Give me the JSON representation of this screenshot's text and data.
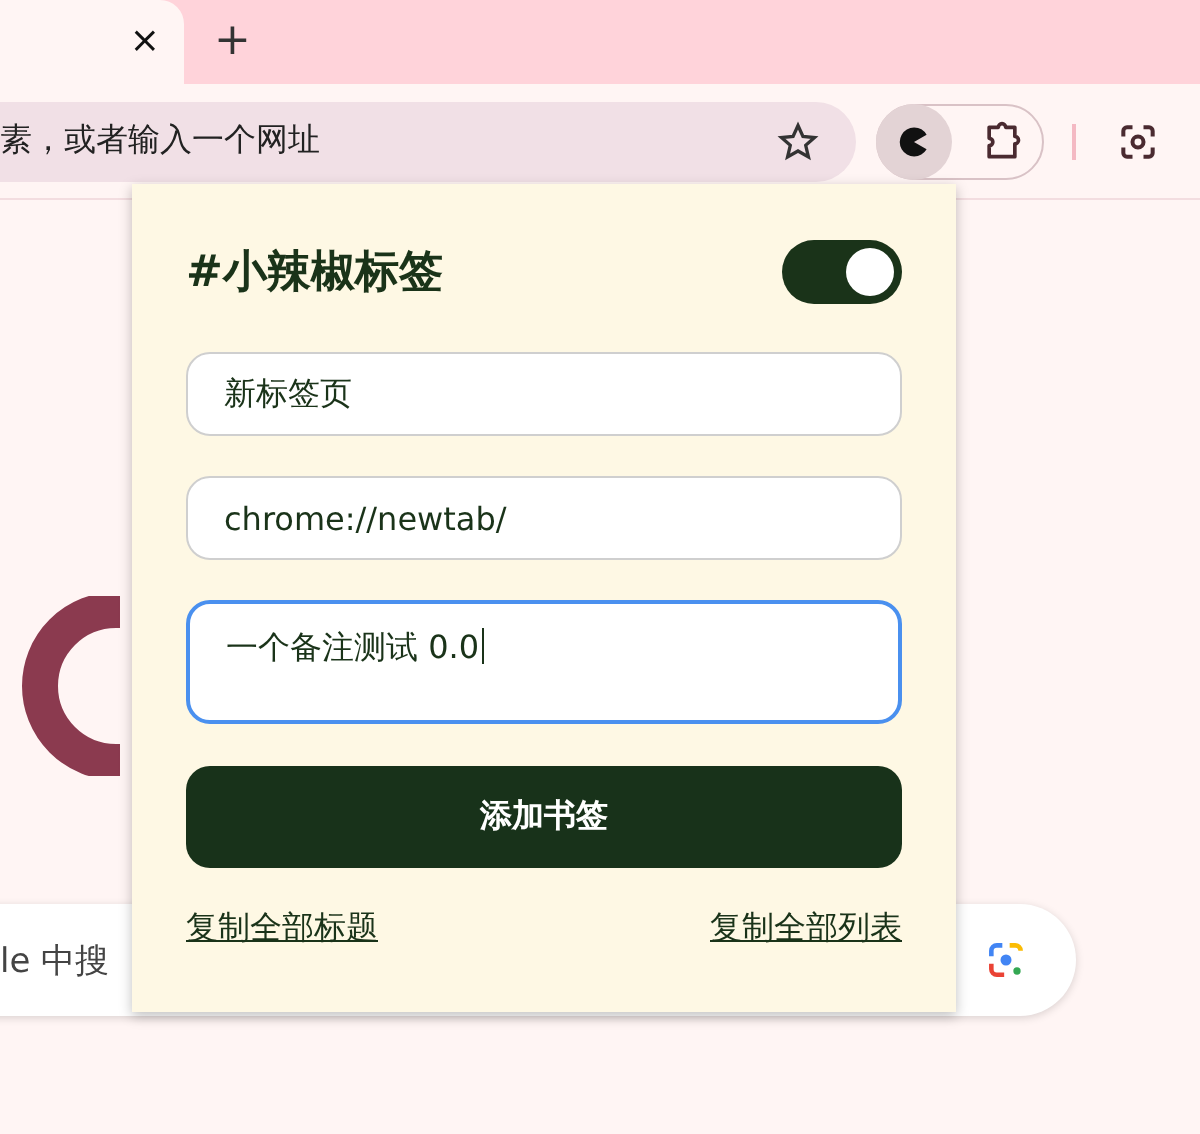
{
  "browser": {
    "tab_close": "×",
    "new_tab": "+",
    "address": "素，或者输入一个网址",
    "search_text": "le 中搜"
  },
  "popup": {
    "title": "#小辣椒标签",
    "enabled": true,
    "fields": [
      {
        "kind": "input",
        "value": "新标签页",
        "focused": false
      },
      {
        "kind": "input",
        "value": "chrome://newtab/",
        "focused": false
      },
      {
        "kind": "textarea",
        "value": "一个备注测试 0.0",
        "focused": true
      }
    ],
    "button": "添加书签",
    "links": [
      "复制全部标题",
      "复制全部列表"
    ]
  }
}
